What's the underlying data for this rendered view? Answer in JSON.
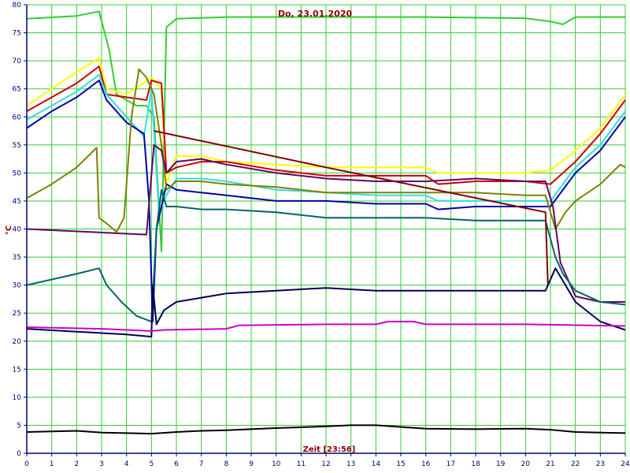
{
  "chart_data": {
    "type": "line",
    "title": "Do, 23.01.2020",
    "xlabel": "Zeit [23:56]",
    "ylabel": "°C",
    "xlim": [
      0,
      24
    ],
    "ylim": [
      0,
      80
    ],
    "x_ticks": [
      "0",
      "1",
      "2",
      "3",
      "4",
      "5",
      "6",
      "7",
      "8",
      "9",
      "10",
      "11",
      "12",
      "13",
      "14",
      "15",
      "16",
      "17",
      "18",
      "19",
      "20",
      "21",
      "22",
      "23",
      "24"
    ],
    "y_ticks": [
      "0",
      "5",
      "10",
      "15",
      "20",
      "25",
      "30",
      "35",
      "40",
      "45",
      "50",
      "55",
      "60",
      "65",
      "70",
      "75",
      "80"
    ],
    "grid": true,
    "colors": {
      "grid": "#33cc33",
      "axis": "#000080",
      "background": "#ffffff"
    },
    "series": [
      {
        "color": "#33cc33",
        "points": [
          [
            0,
            77.5
          ],
          [
            2,
            78
          ],
          [
            2.9,
            78.8
          ],
          [
            3.3,
            72
          ],
          [
            3.6,
            64
          ],
          [
            4.4,
            62
          ],
          [
            4.8,
            62
          ],
          [
            5.1,
            60
          ],
          [
            5.4,
            36
          ],
          [
            5.6,
            76
          ],
          [
            6,
            77.5
          ],
          [
            8,
            77.8
          ],
          [
            12,
            77.8
          ],
          [
            16,
            77.8
          ],
          [
            20,
            77.6
          ],
          [
            21,
            77
          ],
          [
            21.5,
            76.5
          ],
          [
            22,
            77.8
          ],
          [
            24,
            77.8
          ]
        ]
      },
      {
        "color": "#ffff00",
        "points": [
          [
            0,
            62
          ],
          [
            1,
            65
          ],
          [
            2,
            68
          ],
          [
            2.9,
            70.5
          ],
          [
            3.2,
            65
          ],
          [
            4,
            64
          ],
          [
            5,
            67
          ],
          [
            5.4,
            65
          ],
          [
            5.6,
            48
          ],
          [
            6,
            53
          ],
          [
            7,
            53
          ],
          [
            8,
            52
          ],
          [
            10,
            51.5
          ],
          [
            12,
            51
          ],
          [
            14,
            51
          ],
          [
            16,
            51
          ],
          [
            16.5,
            50
          ],
          [
            18,
            50
          ],
          [
            20,
            50
          ],
          [
            21,
            50.5
          ],
          [
            22,
            54
          ],
          [
            23,
            58
          ],
          [
            24,
            64
          ]
        ]
      },
      {
        "color": "#cc0000",
        "points": [
          [
            0,
            61
          ],
          [
            1,
            63.5
          ],
          [
            2,
            66
          ],
          [
            2.9,
            69
          ],
          [
            3.2,
            64
          ],
          [
            4,
            63.5
          ],
          [
            4.8,
            63
          ],
          [
            5,
            66.5
          ],
          [
            5.4,
            66
          ],
          [
            5.6,
            50
          ],
          [
            6,
            51
          ],
          [
            7,
            52
          ],
          [
            8,
            52
          ],
          [
            10,
            50.5
          ],
          [
            12,
            49.5
          ],
          [
            14,
            49.5
          ],
          [
            16,
            49.5
          ],
          [
            16.5,
            48
          ],
          [
            18,
            48.5
          ],
          [
            20,
            48.5
          ],
          [
            21,
            48
          ],
          [
            22,
            52
          ],
          [
            23,
            57
          ],
          [
            24,
            63
          ]
        ]
      },
      {
        "color": "#33dddd",
        "points": [
          [
            0,
            59.5
          ],
          [
            1,
            62
          ],
          [
            2,
            64.5
          ],
          [
            2.9,
            67.5
          ],
          [
            3.2,
            64
          ],
          [
            4,
            60
          ],
          [
            4.7,
            56.5
          ],
          [
            5,
            65
          ],
          [
            5.3,
            43
          ],
          [
            5.6,
            46
          ],
          [
            6,
            49
          ],
          [
            7,
            49
          ],
          [
            8,
            48.5
          ],
          [
            10,
            47
          ],
          [
            12,
            46.5
          ],
          [
            14,
            46
          ],
          [
            16,
            46
          ],
          [
            16.5,
            45
          ],
          [
            18,
            45
          ],
          [
            20,
            45
          ],
          [
            21,
            45
          ],
          [
            22,
            51
          ],
          [
            23,
            55
          ],
          [
            24,
            61
          ]
        ]
      },
      {
        "color": "#0000aa",
        "points": [
          [
            0,
            58
          ],
          [
            1,
            61
          ],
          [
            2,
            63.5
          ],
          [
            2.9,
            66.5
          ],
          [
            3.2,
            63
          ],
          [
            4,
            59
          ],
          [
            4.7,
            57
          ],
          [
            4.9,
            45
          ],
          [
            5.05,
            23.5
          ],
          [
            5.2,
            40
          ],
          [
            5.4,
            44
          ],
          [
            5.6,
            48
          ],
          [
            6,
            47
          ],
          [
            7,
            46.5
          ],
          [
            8,
            46
          ],
          [
            10,
            45
          ],
          [
            12,
            45
          ],
          [
            14,
            44.5
          ],
          [
            16,
            44.5
          ],
          [
            16.5,
            43.5
          ],
          [
            18,
            44
          ],
          [
            20,
            44
          ],
          [
            21,
            44
          ],
          [
            22,
            50
          ],
          [
            23,
            54
          ],
          [
            24,
            60
          ]
        ]
      },
      {
        "color": "#808000",
        "points": [
          [
            0,
            45.5
          ],
          [
            1,
            48
          ],
          [
            2,
            51
          ],
          [
            2.8,
            54.5
          ],
          [
            2.9,
            42
          ],
          [
            3.2,
            41
          ],
          [
            3.6,
            39.5
          ],
          [
            3.9,
            42
          ],
          [
            4.2,
            60
          ],
          [
            4.5,
            68.5
          ],
          [
            4.8,
            67
          ],
          [
            5.1,
            64
          ],
          [
            5.4,
            55
          ],
          [
            5.6,
            47
          ],
          [
            6,
            48.5
          ],
          [
            7,
            48.5
          ],
          [
            8,
            48
          ],
          [
            10,
            47.5
          ],
          [
            12,
            46.5
          ],
          [
            14,
            46.5
          ],
          [
            16,
            46.5
          ],
          [
            18,
            46.5
          ],
          [
            20,
            46
          ],
          [
            20.8,
            46
          ],
          [
            21.2,
            40
          ],
          [
            21.6,
            43
          ],
          [
            22,
            45
          ],
          [
            23,
            48
          ],
          [
            23.8,
            51.5
          ],
          [
            24,
            51
          ]
        ]
      },
      {
        "color": "#660066",
        "points": [
          [
            0,
            40
          ],
          [
            4.8,
            39
          ],
          [
            5.1,
            55
          ],
          [
            5.4,
            54
          ],
          [
            5.6,
            50
          ],
          [
            6,
            52
          ],
          [
            7,
            52.5
          ],
          [
            8,
            51.5
          ],
          [
            10,
            50
          ],
          [
            12,
            49
          ],
          [
            14,
            48.5
          ],
          [
            16,
            48.5
          ],
          [
            18,
            49
          ],
          [
            20,
            48.5
          ],
          [
            20.8,
            48.5
          ],
          [
            21.1,
            44
          ],
          [
            21.4,
            34
          ],
          [
            22,
            28
          ],
          [
            23,
            27
          ],
          [
            24,
            27
          ]
        ]
      },
      {
        "color": "#006666",
        "points": [
          [
            0,
            30
          ],
          [
            1,
            31
          ],
          [
            2,
            32
          ],
          [
            2.9,
            33
          ],
          [
            3.2,
            30
          ],
          [
            3.8,
            27
          ],
          [
            4.4,
            24.5
          ],
          [
            5,
            23.5
          ],
          [
            5.2,
            40
          ],
          [
            5.4,
            47
          ],
          [
            5.6,
            44
          ],
          [
            6,
            44
          ],
          [
            7,
            43.5
          ],
          [
            8,
            43.5
          ],
          [
            10,
            43
          ],
          [
            12,
            42
          ],
          [
            14,
            42
          ],
          [
            16,
            42
          ],
          [
            18,
            41.5
          ],
          [
            20,
            41.5
          ],
          [
            20.8,
            41.5
          ],
          [
            21.2,
            35
          ],
          [
            21.5,
            32
          ],
          [
            22,
            29
          ],
          [
            23,
            27
          ],
          [
            24,
            26.5
          ]
        ]
      },
      {
        "color": "#800000",
        "points": [
          [
            5.1,
            57.5
          ],
          [
            12,
            51
          ],
          [
            20.8,
            43
          ],
          [
            20.9,
            30
          ]
        ]
      },
      {
        "color": "#000055",
        "points": [
          [
            0,
            22.2
          ],
          [
            2,
            21.7
          ],
          [
            4,
            21.2
          ],
          [
            5,
            20.8
          ],
          [
            5.05,
            30
          ],
          [
            5.2,
            23
          ],
          [
            5.5,
            25.5
          ],
          [
            6,
            27
          ],
          [
            8,
            28.5
          ],
          [
            10,
            29
          ],
          [
            12,
            29.5
          ],
          [
            14,
            29
          ],
          [
            16,
            29
          ],
          [
            18,
            29
          ],
          [
            20,
            29
          ],
          [
            20.8,
            29
          ],
          [
            21.2,
            33
          ],
          [
            21.6,
            30
          ],
          [
            22,
            27
          ],
          [
            23,
            23.5
          ],
          [
            24,
            22
          ]
        ]
      },
      {
        "color": "#cc00cc",
        "points": [
          [
            0,
            22.5
          ],
          [
            3,
            22.2
          ],
          [
            5,
            21.8
          ],
          [
            5.5,
            22
          ],
          [
            8,
            22.2
          ],
          [
            8.5,
            22.8
          ],
          [
            12,
            23
          ],
          [
            14,
            23
          ],
          [
            14.5,
            23.5
          ],
          [
            15.5,
            23.5
          ],
          [
            16,
            23
          ],
          [
            20,
            23
          ],
          [
            24,
            22.7
          ]
        ]
      },
      {
        "color": "#000000",
        "points": [
          [
            0,
            3.8
          ],
          [
            2,
            4
          ],
          [
            3,
            3.7
          ],
          [
            4,
            3.6
          ],
          [
            5,
            3.5
          ],
          [
            6,
            3.8
          ],
          [
            7,
            4
          ],
          [
            8,
            4.1
          ],
          [
            10,
            4.5
          ],
          [
            12,
            4.8
          ],
          [
            13,
            5
          ],
          [
            14,
            5
          ],
          [
            15,
            4.7
          ],
          [
            16,
            4.4
          ],
          [
            18,
            4.3
          ],
          [
            20,
            4.4
          ],
          [
            21,
            4.2
          ],
          [
            22,
            3.8
          ],
          [
            24,
            3.6
          ]
        ]
      }
    ]
  }
}
